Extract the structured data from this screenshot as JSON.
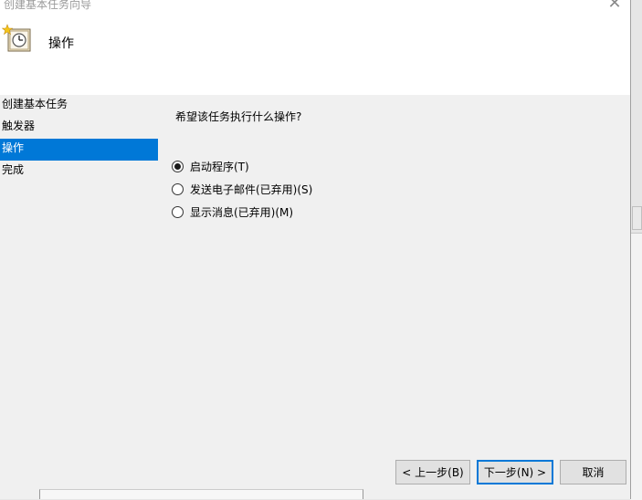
{
  "window": {
    "title": "创建基本任务向导",
    "close_glyph": "✕"
  },
  "header": {
    "page_title": "操作"
  },
  "steps": [
    {
      "label": "创建基本任务",
      "active": false
    },
    {
      "label": "触发器",
      "active": false
    },
    {
      "label": "操作",
      "active": true
    },
    {
      "label": "完成",
      "active": false
    }
  ],
  "main": {
    "question": "希望该任务执行什么操作?",
    "options": [
      {
        "label": "启动程序(T)",
        "selected": true
      },
      {
        "label": "发送电子邮件(已弃用)(S)",
        "selected": false
      },
      {
        "label": "显示消息(已弃用)(M)",
        "selected": false
      }
    ]
  },
  "buttons": {
    "back": "< 上一步(B)",
    "next": "下一步(N) >",
    "cancel": "取消"
  },
  "colors": {
    "accent": "#0078d7",
    "dialog_bg": "#f0f0f0",
    "header_bg": "#ffffff"
  }
}
